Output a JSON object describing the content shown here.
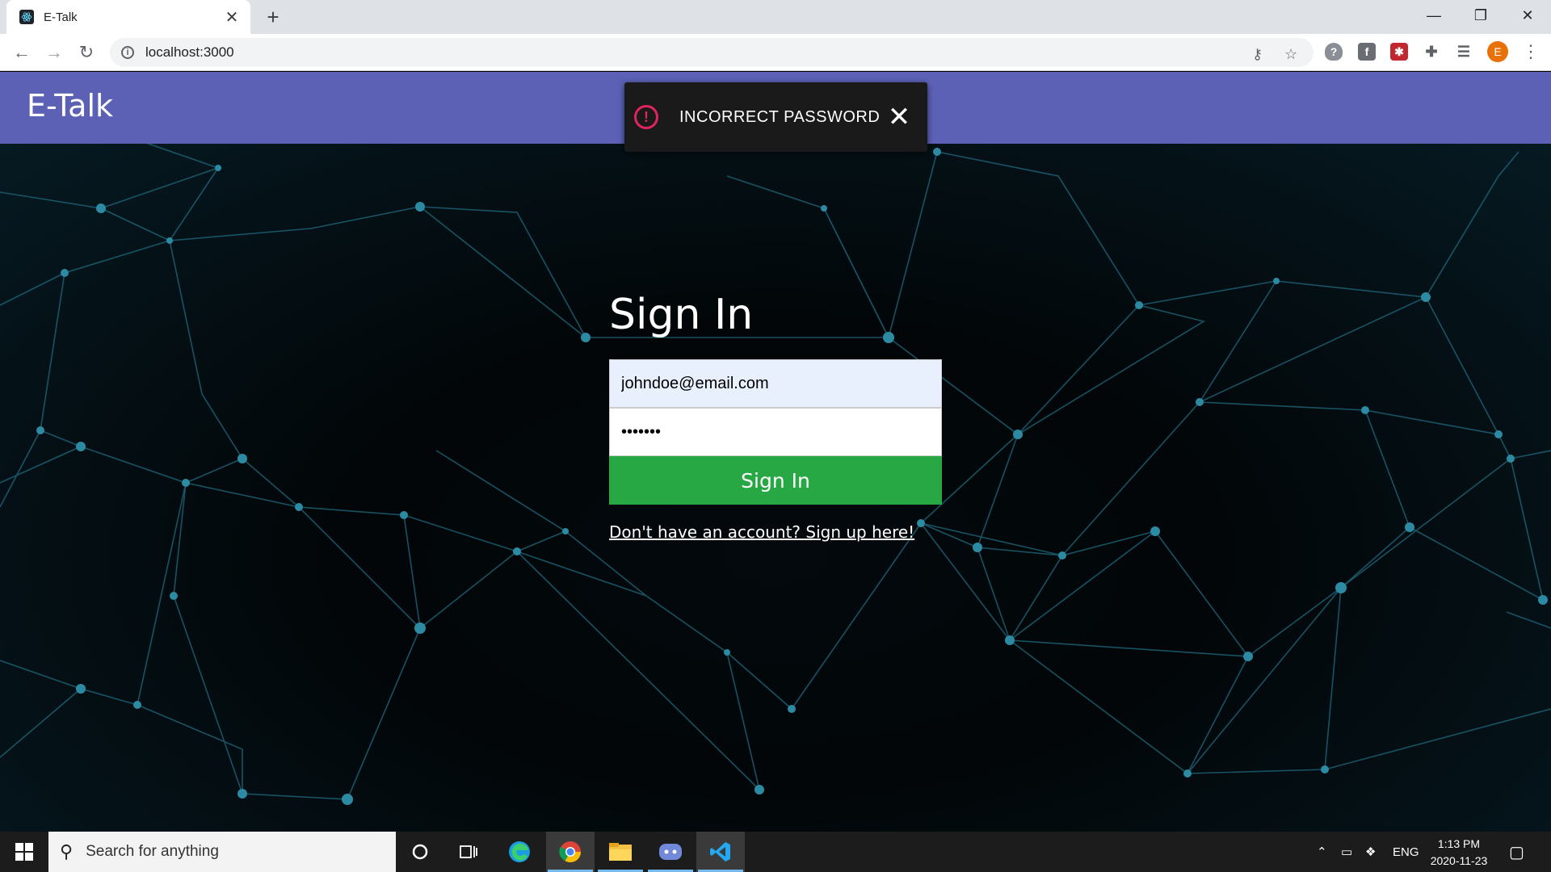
{
  "browser": {
    "tab_title": "E-Talk",
    "url": "localhost:3000",
    "profile_initial": "E"
  },
  "app": {
    "logo": "E-Talk"
  },
  "toast": {
    "message": "INCORRECT PASSWORD",
    "icon": "alert-circle-icon"
  },
  "form": {
    "title": "Sign In",
    "email_value": "johndoe@email.com",
    "password_value": "•••••••",
    "submit_label": "Sign In",
    "signup_link": "Don't have an account? Sign up here!",
    "submit_color": "#28a745"
  },
  "taskbar": {
    "search_placeholder": "Search for anything",
    "language": "ENG",
    "time": "1:13 PM",
    "date": "2020-11-23"
  },
  "colors": {
    "header": "#5c61b5",
    "toast_bg": "#1a1a1a",
    "toast_icon": "#e0245e"
  }
}
